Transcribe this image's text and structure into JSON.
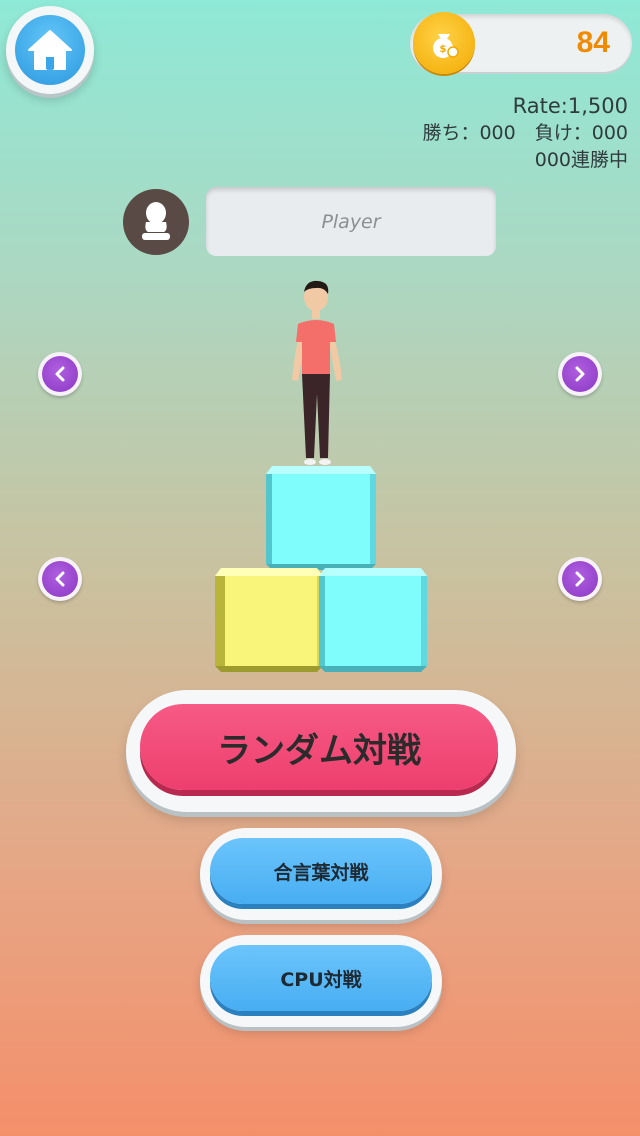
{
  "header": {
    "home_icon": "home-icon",
    "coin_icon": "money-bag-icon",
    "coins": "84"
  },
  "stats": {
    "rate": "Rate:1,500",
    "record": "勝ち：000　負け：000",
    "streak": "000連勝中"
  },
  "player": {
    "avatar_icon": "user-silhouette-icon",
    "name_placeholder": "Player"
  },
  "selectors": {
    "prev_icon": "chevron-left-icon",
    "next_icon": "chevron-right-icon"
  },
  "colors": {
    "block_cyan": "#7ffcfc",
    "block_yellow": "#f8f57a",
    "random_button": "#ee3f6e",
    "blue_button": "#47aef2",
    "coin_text": "#f08a00"
  },
  "buttons": {
    "random_battle": "ランダム対戦",
    "password_battle": "合言葉対戦",
    "cpu_battle": "CPU対戦"
  }
}
